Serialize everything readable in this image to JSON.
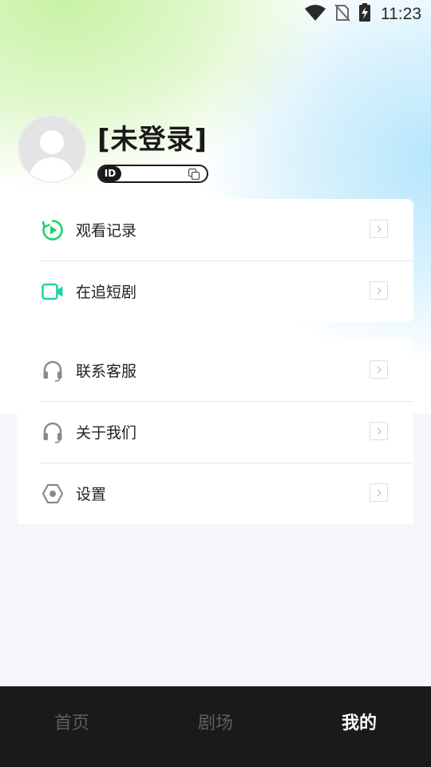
{
  "status_bar": {
    "time": "11:23",
    "icons": [
      "wifi-icon",
      "no-sim-icon",
      "battery-charging-icon"
    ]
  },
  "profile": {
    "username": "[未登录]",
    "id_tag": "ID",
    "id_value": "",
    "avatar_icon": "default-avatar-icon",
    "copy_icon": "copy-icon"
  },
  "menu_group_1": [
    {
      "label": "观看记录",
      "icon": "play-history-icon"
    },
    {
      "label": "在追短剧",
      "icon": "video-camera-icon"
    }
  ],
  "menu_group_2": [
    {
      "label": "联系客服",
      "icon": "headset-icon"
    },
    {
      "label": "关于我们",
      "icon": "headset-icon"
    },
    {
      "label": "设置",
      "icon": "settings-hexagon-icon"
    }
  ],
  "tabbar": {
    "tabs": [
      {
        "label": "首页",
        "active": false
      },
      {
        "label": "剧场",
        "active": false
      },
      {
        "label": "我的",
        "active": true
      }
    ]
  },
  "colors": {
    "accent_green": "#1fd36a",
    "accent_teal": "#21d4a8",
    "tabbar_bg": "#1a1a1a",
    "page_bg": "#f5f6fa"
  }
}
